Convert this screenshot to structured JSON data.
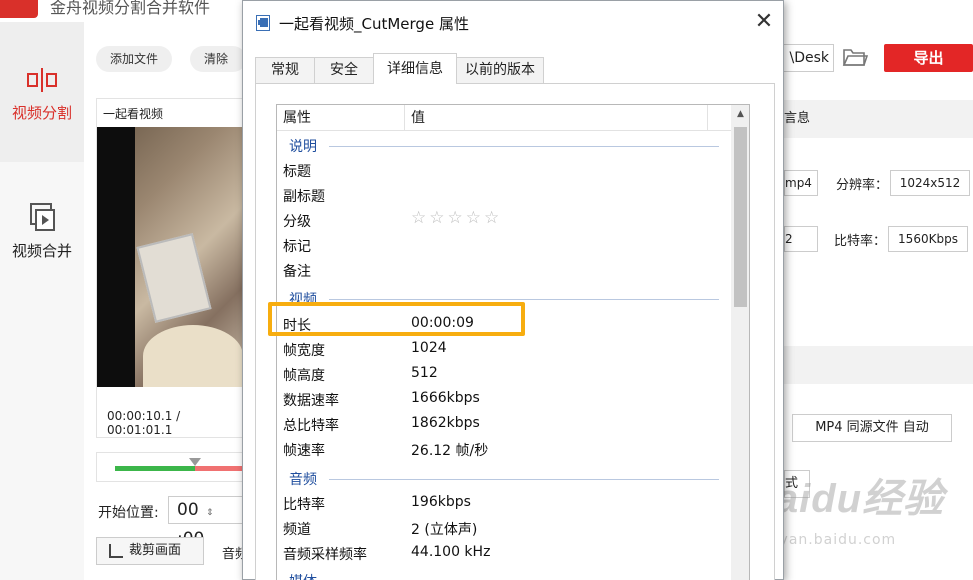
{
  "app": {
    "title": "金舟视频分割合并软件",
    "brand_color": "#d9302a"
  },
  "sidebar": {
    "items": [
      {
        "label": "视频分割",
        "icon": "split-icon",
        "active": true
      },
      {
        "label": "视频合并",
        "icon": "merge-icon",
        "active": false
      }
    ]
  },
  "toolbar": {
    "add_file": "添加文件",
    "clear_video": "清除视",
    "output_path": "\\Desk",
    "export": "导出"
  },
  "video": {
    "name": "一起看视频",
    "time": "00:00:10.1 / 00:01:01.1",
    "start_label": "开始位置:",
    "start_value": "00",
    "start_sep": ":00",
    "crop_label": "裁剪画面",
    "audio_label": "音频"
  },
  "right_panel": {
    "info_title": "言息",
    "format_value": "mp4",
    "resolution_label": "分辨率：",
    "resolution_value": "1024x512",
    "fps_value": "2",
    "bitrate_label": "比特率：",
    "bitrate_value": "1560Kbps",
    "output_format": "MP4 同源文件 自动",
    "style_value": "式"
  },
  "watermark": {
    "main": "Baidu经验",
    "sub": "jingyan.baidu.com"
  },
  "dialog": {
    "title": "一起看视频_CutMerge 属性",
    "close": "✕",
    "tabs": [
      "常规",
      "安全",
      "详细信息",
      "以前的版本"
    ],
    "active_tab": 2,
    "columns": {
      "property": "属性",
      "value": "值"
    },
    "groups": {
      "description": "说明",
      "video": "视频",
      "audio": "音频",
      "media": "媒体"
    },
    "description_rows": [
      {
        "key": "标题",
        "value": ""
      },
      {
        "key": "副标题",
        "value": ""
      },
      {
        "key": "分级",
        "value": "☆☆☆☆☆"
      },
      {
        "key": "标记",
        "value": ""
      },
      {
        "key": "备注",
        "value": ""
      }
    ],
    "video_rows": [
      {
        "key": "时长",
        "value": "00:00:09"
      },
      {
        "key": "帧宽度",
        "value": "1024"
      },
      {
        "key": "帧高度",
        "value": "512"
      },
      {
        "key": "数据速率",
        "value": "1666kbps"
      },
      {
        "key": "总比特率",
        "value": "1862kbps"
      },
      {
        "key": "帧速率",
        "value": "26.12 帧/秒"
      }
    ],
    "audio_rows": [
      {
        "key": "比特率",
        "value": "196kbps"
      },
      {
        "key": "频道",
        "value": "2 (立体声)"
      },
      {
        "key": "音频采样频率",
        "value": "44.100 kHz"
      }
    ],
    "highlight_color": "#f7ad0f"
  }
}
